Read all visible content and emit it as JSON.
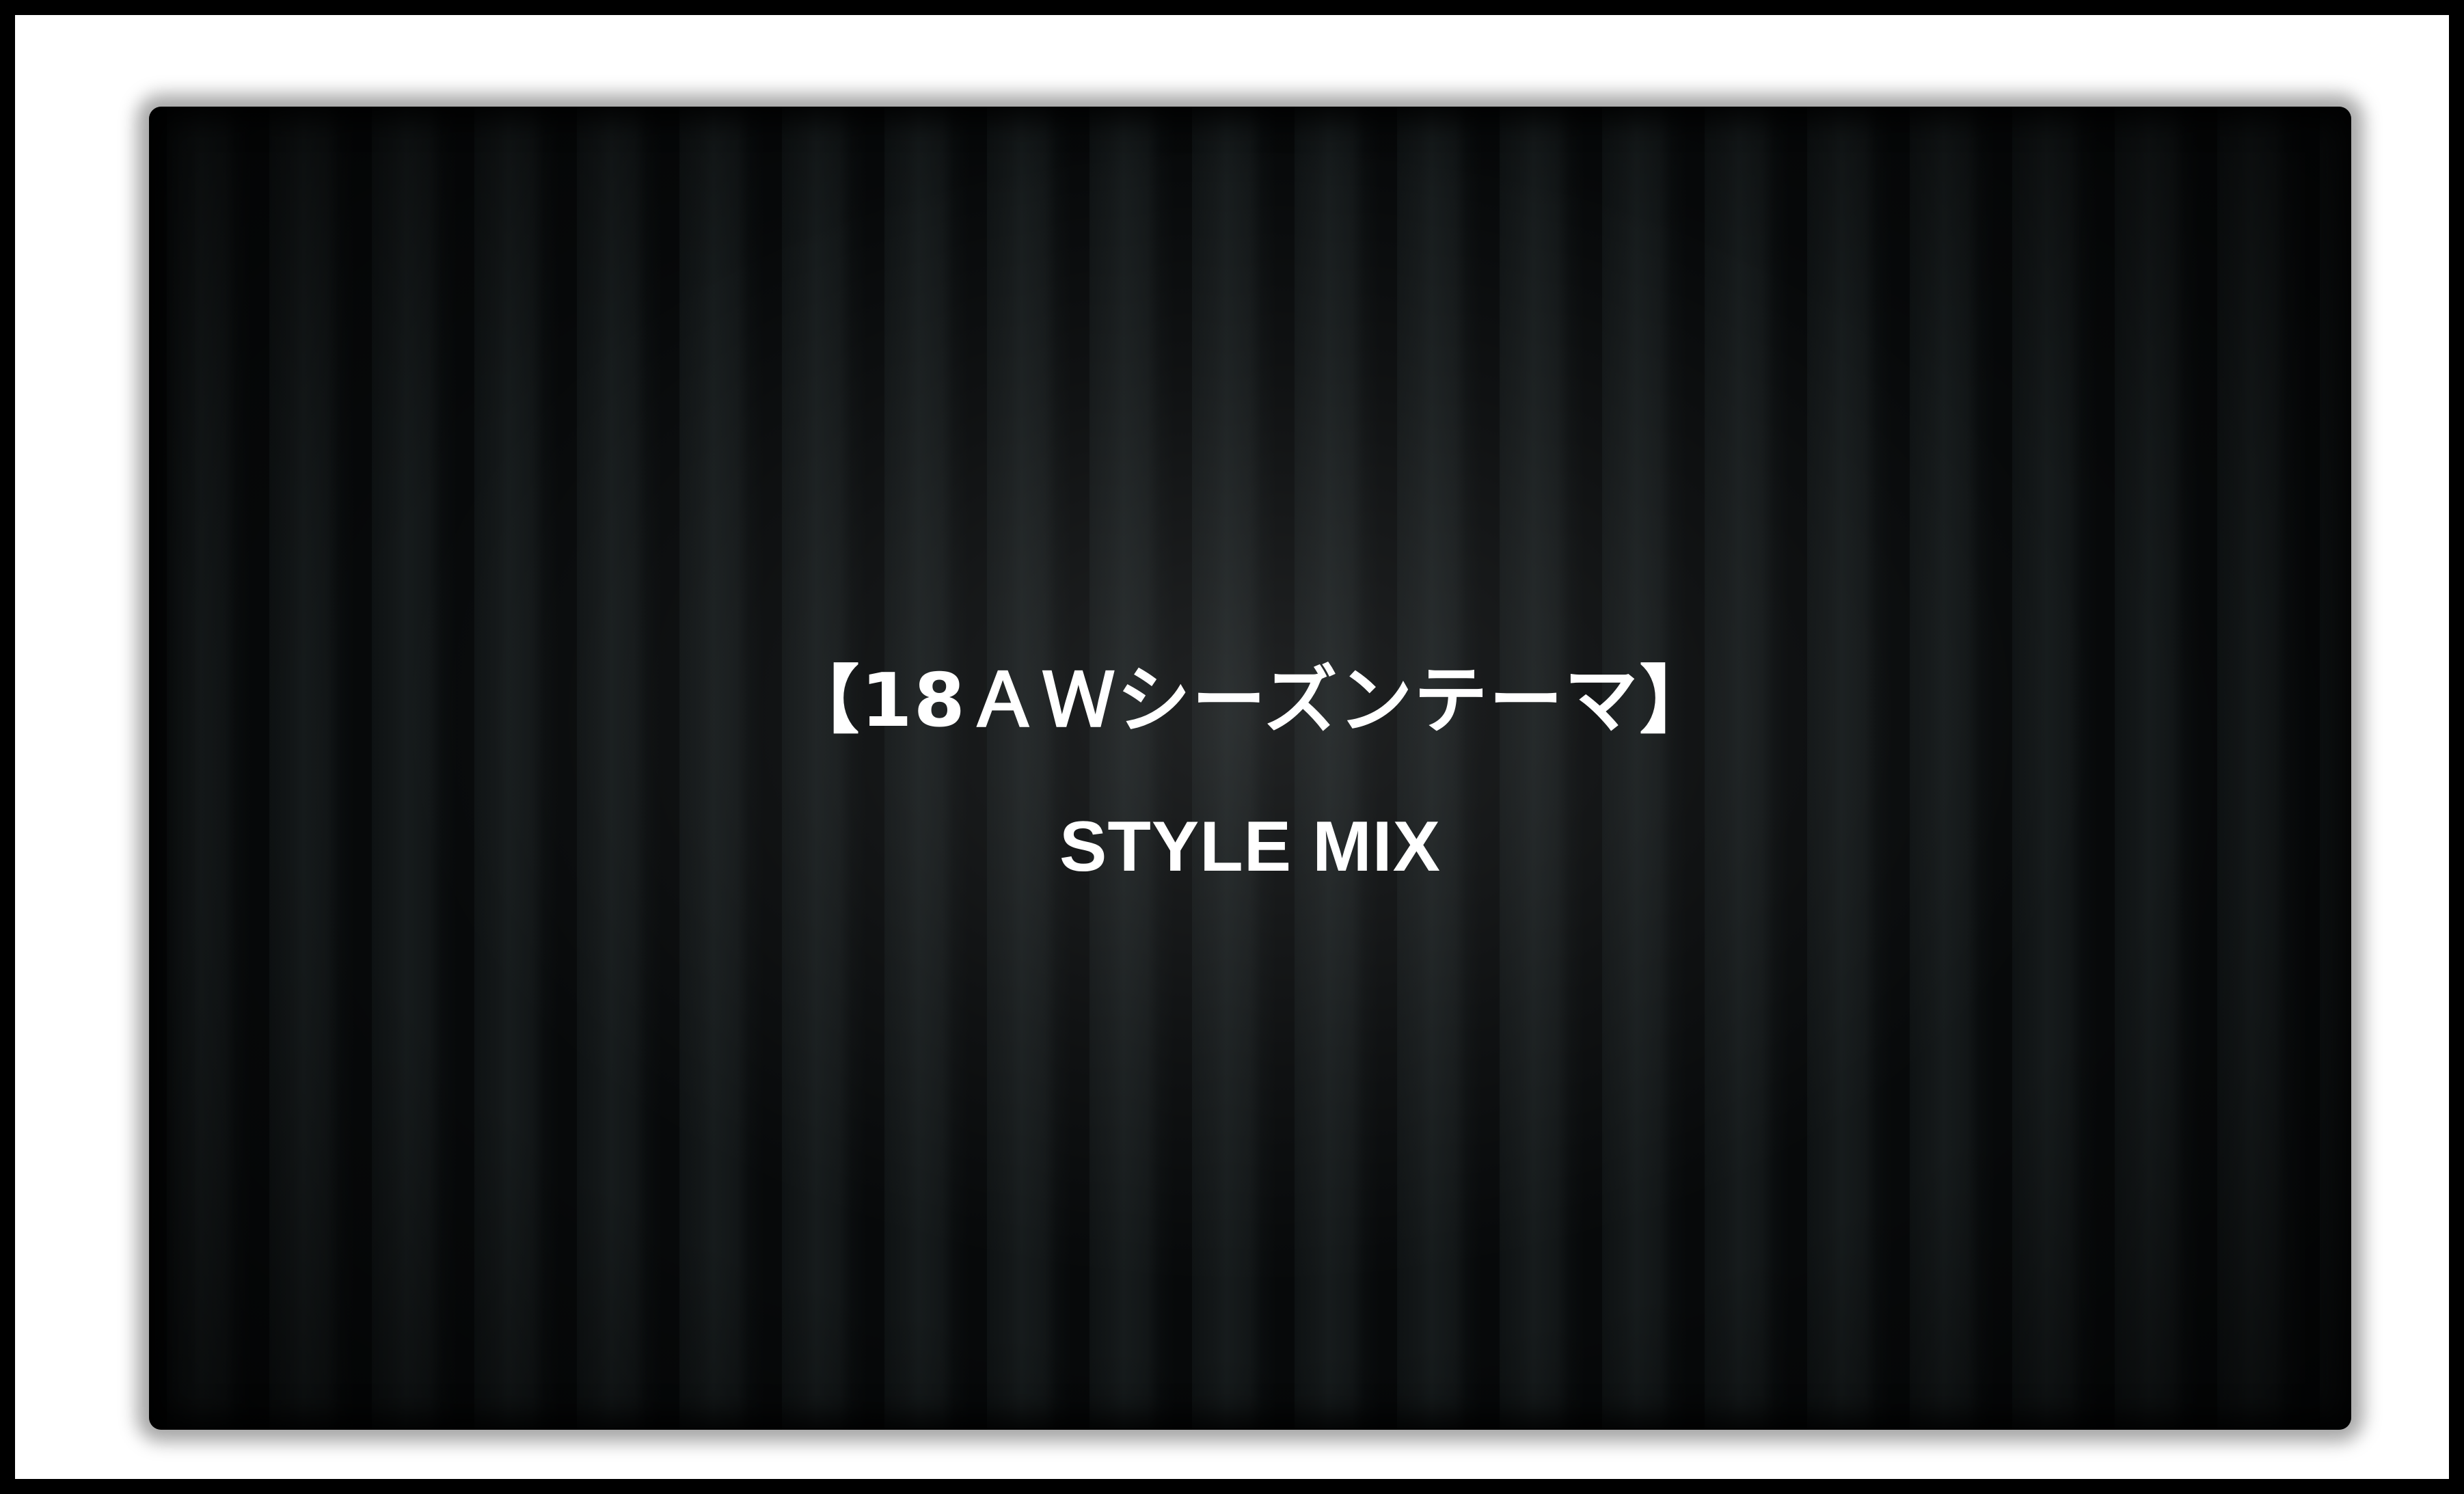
{
  "slide": {
    "headline": "【18ＡＷシーズンテーマ】",
    "subline": "STYLE MIX"
  },
  "colors": {
    "frame_border": "#000000",
    "frame_background": "#ffffff",
    "panel_background": "#0b0d0e",
    "text": "#ffffff"
  }
}
